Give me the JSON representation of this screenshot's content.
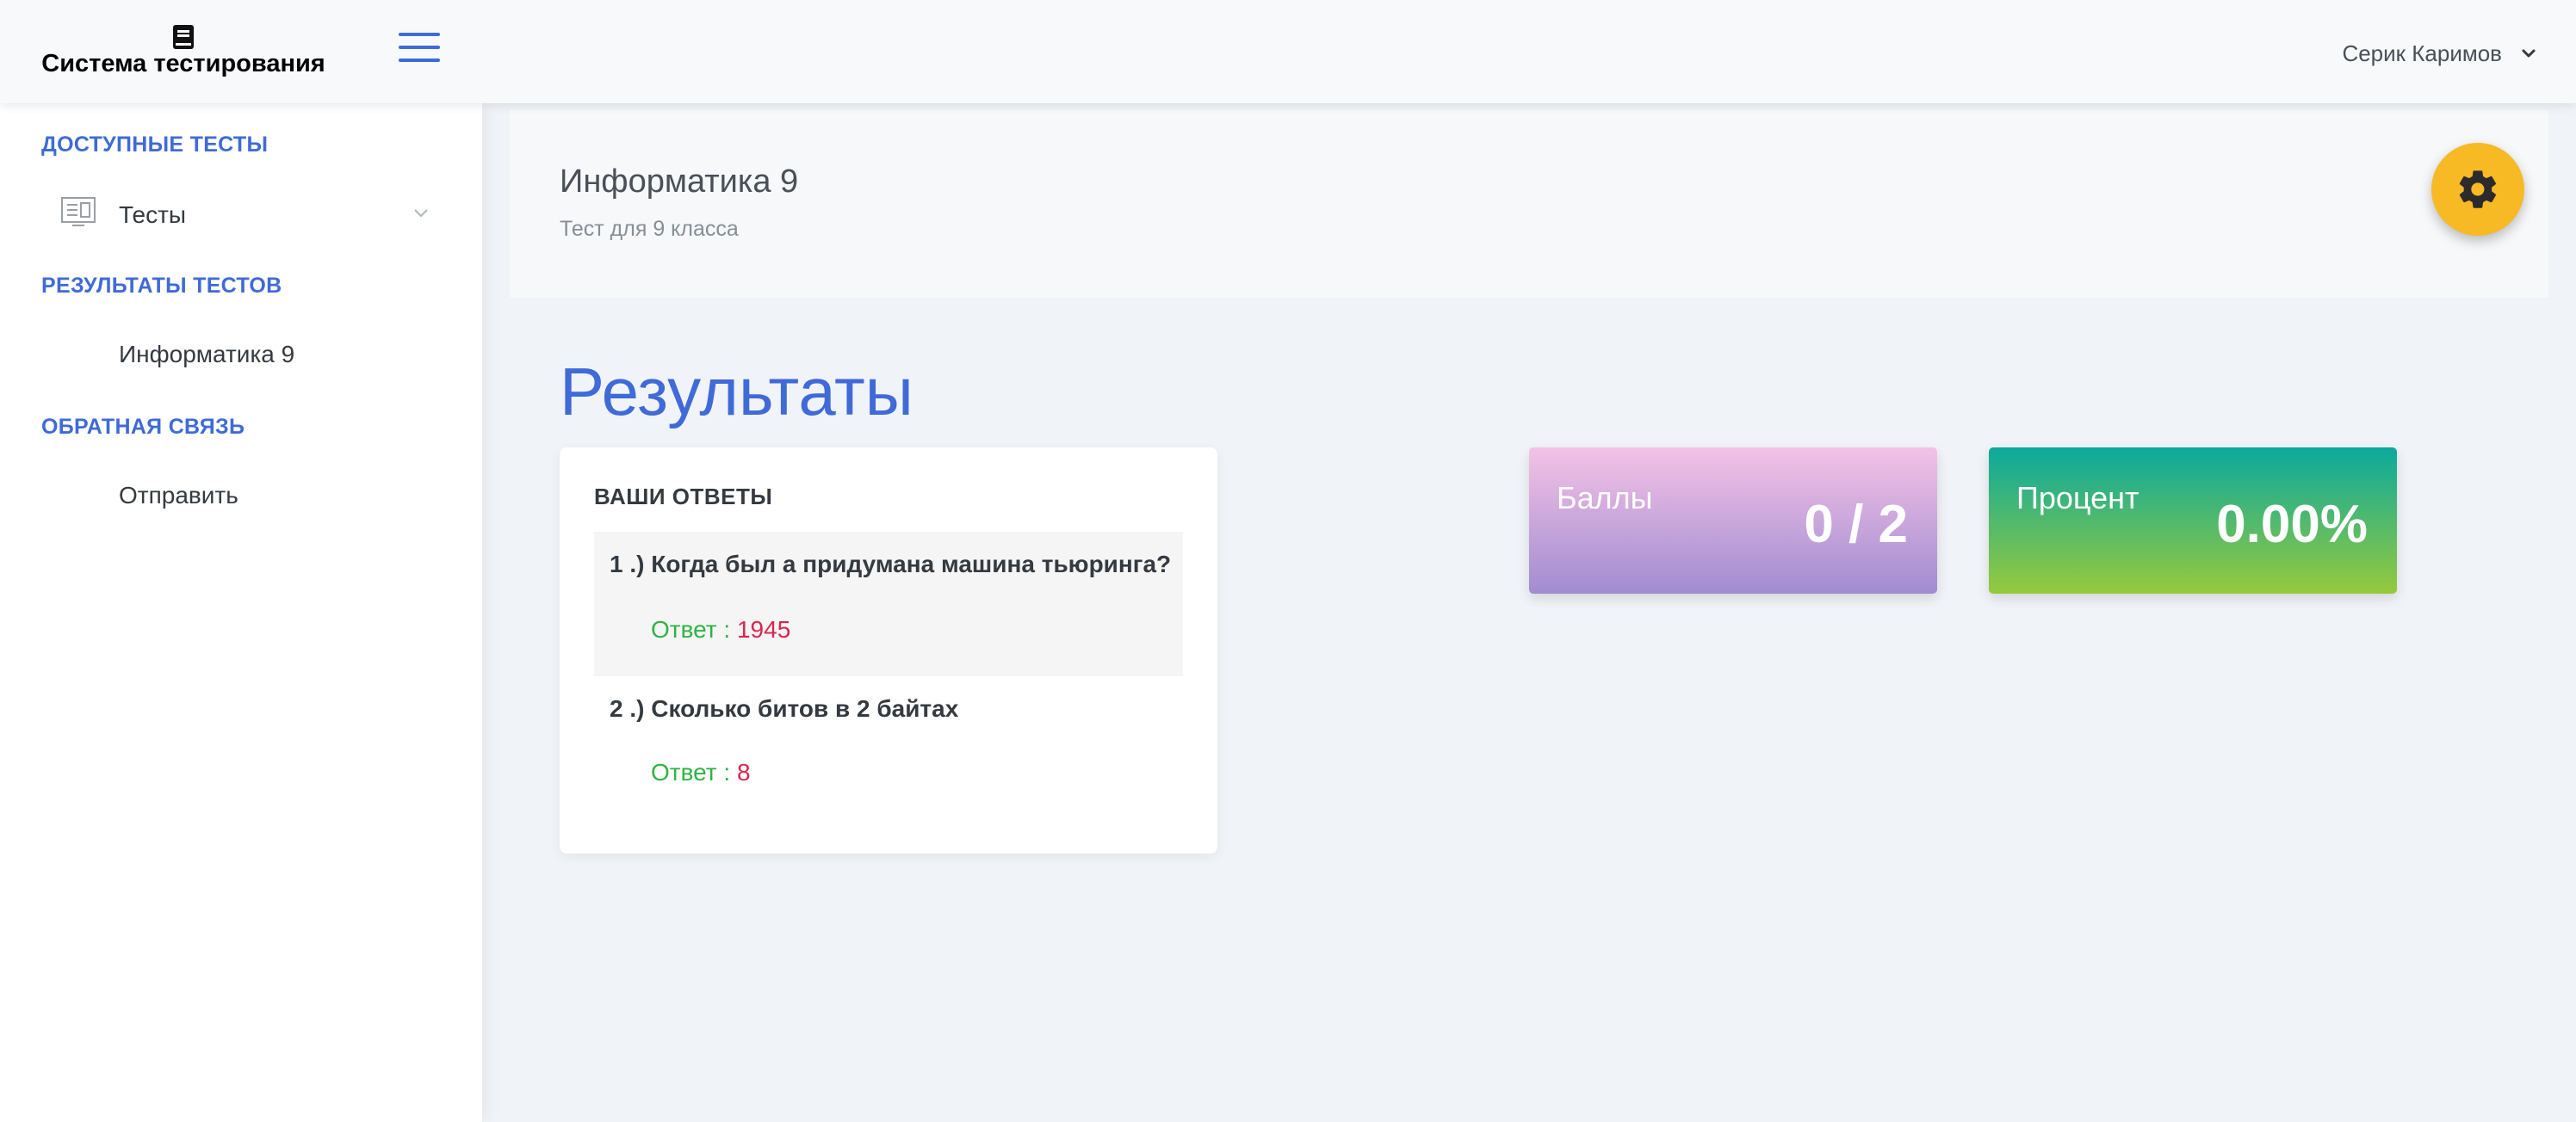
{
  "app": {
    "title": "Система тестирования",
    "logo_icon": "book-icon",
    "accent_color": "#3f6ad8"
  },
  "header": {
    "user_name": "Серик Каримов"
  },
  "sidebar": {
    "sections": [
      {
        "heading": "ДОСТУПНЫЕ ТЕСТЫ",
        "items": [
          {
            "label": "Тесты",
            "icon": "monitor-icon",
            "has_chevron": true
          }
        ]
      },
      {
        "heading": "РЕЗУЛЬТАТЫ ТЕСТОВ",
        "items": [
          {
            "label": "Информатика 9"
          }
        ]
      },
      {
        "heading": "ОБРАТНАЯ СВЯЗЬ",
        "items": [
          {
            "label": "Отправить"
          }
        ]
      }
    ]
  },
  "page": {
    "title": "Информатика 9",
    "subtitle": "Тест для 9 класса"
  },
  "results": {
    "heading": "Результаты",
    "answers_title": "ВАШИ ОТВЕТЫ",
    "questions": [
      {
        "question": "1 .) Когда был а придумана машина тьюринга?",
        "answer_prefix": "Ответ :",
        "answer": "1945"
      },
      {
        "question": "2 .) Сколько битов в 2 байтах",
        "answer_prefix": "Ответ :",
        "answer": "8"
      }
    ],
    "score": {
      "label": "Баллы",
      "value": "0 / 2"
    },
    "percent": {
      "label": "Процент",
      "value": "0.00%"
    }
  }
}
